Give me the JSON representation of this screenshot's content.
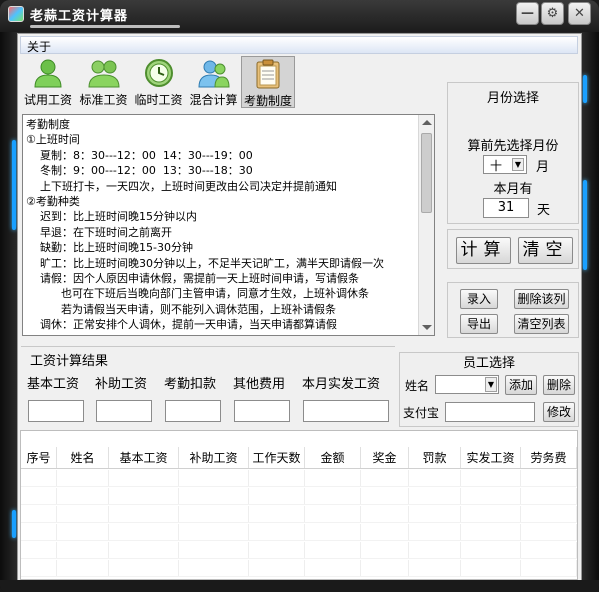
{
  "window": {
    "title": "老蒜工资计算器",
    "controls": {
      "minimize": "—",
      "settings": "⚙",
      "close": "✕"
    }
  },
  "menu": {
    "about": "关于"
  },
  "toolbar": [
    {
      "label": "试用工资",
      "icon": "person-icon"
    },
    {
      "label": "标准工资",
      "icon": "people-icon"
    },
    {
      "label": "临时工资",
      "icon": "clock-icon"
    },
    {
      "label": "混合计算",
      "icon": "group-icon"
    },
    {
      "label": "考勤制度",
      "icon": "clipboard-icon",
      "selected": true
    }
  ],
  "notes": {
    "lines": [
      "考勤制度",
      "①上班时间",
      "    夏制：8：30---12：00  14：30---19：00",
      "    冬制：9：00---12：00  13：30---18：30",
      "    上下班打卡，一天四次，上班时间更改由公司决定并提前通知",
      "②考勤种类",
      "    迟到：比上班时间晚15分钟以内",
      "    早退：在下班时间之前离开",
      "    缺勤：比上班时间晚15-30分钟",
      "    旷工：比上班时间晚30分钟以上，不足半天记旷工，满半天即请假一次",
      "    请假：因个人原因申请休假，需提前一天上班时间申请，写请假条",
      "          也可在下班后当晚向部门主管申请，同意才生效，上班补调休条",
      "          若为请假当天申请，则不能列入调休范围，上班补请假条",
      "    调休：正常安排个人调休，提前一天申请，当天申请都算请假"
    ]
  },
  "month": {
    "title": "月份选择",
    "instruction": "算前先选择月份",
    "value": "十",
    "unit": "月",
    "days_label": "本月有",
    "days_value": "31",
    "days_unit": "天"
  },
  "calc": {
    "compute": "计算",
    "clear": "清空"
  },
  "list_actions": {
    "add": "录入",
    "delete": "删除该列",
    "export": "导出",
    "clear_list": "清空列表"
  },
  "results": {
    "title": "工资计算结果",
    "labels": [
      "基本工资",
      "补助工资",
      "考勤扣款",
      "其他费用",
      "本月实发工资"
    ]
  },
  "employee": {
    "title": "员工选择",
    "name_label": "姓名",
    "add": "添加",
    "delete": "删除",
    "alipay_label": "支付宝",
    "modify": "修改"
  },
  "grid": {
    "columns": [
      "序号",
      "姓名",
      "基本工资",
      "补助工资",
      "工作天数",
      "金额",
      "奖金",
      "罚款",
      "实发工资",
      "劳务费"
    ]
  }
}
